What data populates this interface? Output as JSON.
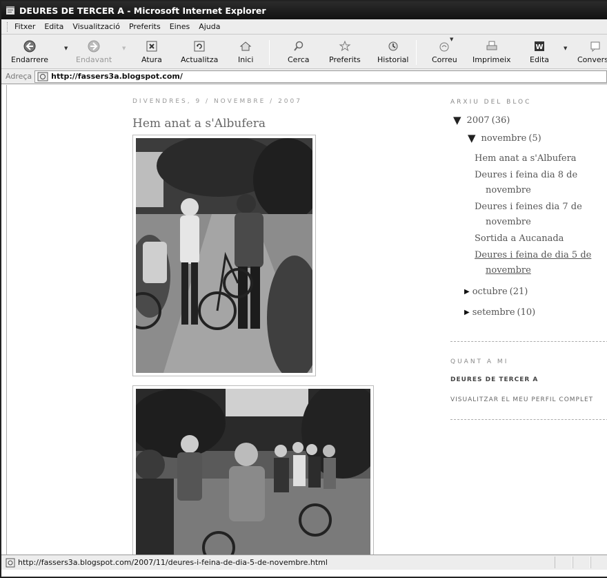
{
  "window": {
    "title": "DEURES DE TERCER A - Microsoft Internet Explorer"
  },
  "menu": [
    "Fitxer",
    "Edita",
    "Visualització",
    "Preferits",
    "Eines",
    "Ajuda"
  ],
  "toolbar": {
    "back": "Endarrere",
    "forward": "Endavant",
    "stop": "Atura",
    "refresh": "Actualitza",
    "home": "Inici",
    "search": "Cerca",
    "favorites": "Preferits",
    "history": "Historial",
    "mail": "Correu",
    "print": "Imprimeix",
    "edit": "Edita",
    "discuss": "Conversa"
  },
  "address": {
    "label": "Adreça",
    "url": "http://fassers3a.blogspot.com/"
  },
  "post": {
    "date": "DIVENDRES, 9 / NOVEMBRE / 2007",
    "title": "Hem anat a s'Albufera"
  },
  "sidebar": {
    "archive_heading": "ARXIU DEL BLOC",
    "year": {
      "label": "2007",
      "count": "(36)"
    },
    "month_open": {
      "label": "novembre",
      "count": "(5)"
    },
    "posts": [
      "Hem anat a s'Albufera",
      "Deures i feina dia 8 de",
      "novembre",
      "Deures i feines dia 7 de",
      "novembre",
      "Sortida a Aucanada",
      "Deures i feina de dia 5 de",
      "novembre"
    ],
    "other_months": [
      {
        "label": "octubre",
        "count": "(21)"
      },
      {
        "label": "setembre",
        "count": "(10)"
      }
    ],
    "about_heading": "QUANT A MI",
    "about_name": "DEURES DE TERCER A",
    "about_link": "VISUALITZAR EL MEU PERFIL COMPLET"
  },
  "status": {
    "text": "http://fassers3a.blogspot.com/2007/11/deures-i-feina-de-dia-5-de-novembre.html"
  }
}
